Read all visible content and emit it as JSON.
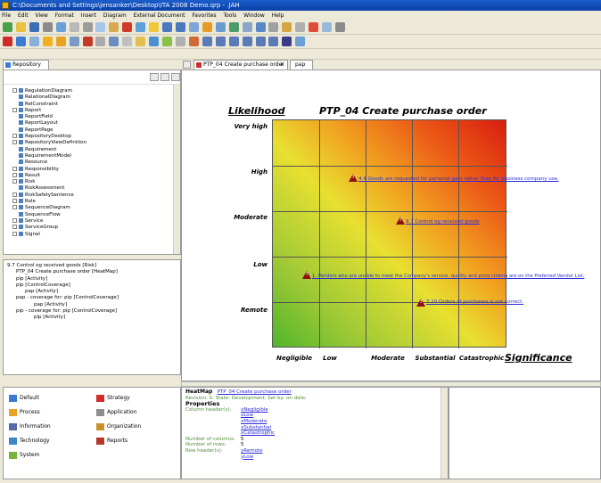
{
  "window": {
    "title": "C:\\Documents and Settings\\jensanker\\Desktop\\ITA 2008 Demo.qrp - .JAH"
  },
  "menu": [
    "File",
    "Edit",
    "View",
    "Format",
    "Insert",
    "Diagram",
    "External Document",
    "Favorites",
    "Tools",
    "Window",
    "Help"
  ],
  "left_tab": {
    "label": "Repository"
  },
  "tree": {
    "items": [
      {
        "label": "RegulationDiagram",
        "expand": true
      },
      {
        "label": "RelationalDiagram",
        "expand": false
      },
      {
        "label": "RelConstraint",
        "expand": false
      },
      {
        "label": "Report",
        "expand": true
      },
      {
        "label": "ReportField",
        "expand": false
      },
      {
        "label": "ReportLayout",
        "expand": false
      },
      {
        "label": "ReportPage",
        "expand": false
      },
      {
        "label": "RepositoryDesktop",
        "expand": true
      },
      {
        "label": "RepositoryViewDefinition",
        "expand": true
      },
      {
        "label": "Requirement",
        "expand": false
      },
      {
        "label": "RequirementModel",
        "expand": false
      },
      {
        "label": "Resource",
        "expand": false
      },
      {
        "label": "Responsibility",
        "expand": true
      },
      {
        "label": "Result",
        "expand": true
      },
      {
        "label": "Risk",
        "expand": true
      },
      {
        "label": "RiskAssessment",
        "expand": false
      },
      {
        "label": "RiskSafetySentence",
        "expand": true
      },
      {
        "label": "Role",
        "expand": true
      },
      {
        "label": "SequenceDiagram",
        "expand": true
      },
      {
        "label": "SequenceFlow",
        "expand": false
      },
      {
        "label": "Service",
        "expand": true
      },
      {
        "label": "ServiceGroup",
        "expand": true
      },
      {
        "label": "Signal",
        "expand": true
      }
    ]
  },
  "subtree": {
    "items": [
      {
        "label": "9.7 Control og received goods [Risk]",
        "indent": 0
      },
      {
        "label": "PTP_04 Create purchase order [HeatMap]",
        "indent": 1
      },
      {
        "label": "pip [Activity]",
        "indent": 1
      },
      {
        "label": "pip [ControlCoverage]",
        "indent": 1
      },
      {
        "label": "pap [Activity]",
        "indent": 2
      },
      {
        "label": "pap - coverage for: pip [ControlCoverage]",
        "indent": 1
      },
      {
        "label": "pap [Activity]",
        "indent": 3
      },
      {
        "label": "pip - coverage for: pip [ControlCoverage]",
        "indent": 1
      },
      {
        "label": "pip [Activity]",
        "indent": 3
      }
    ]
  },
  "editor_tabs": [
    {
      "label": "PTP_04 Create purchase order"
    },
    {
      "label": "pap"
    }
  ],
  "heatmap": {
    "title": "PTP_04 Create purchase order",
    "y_title": "Likelihood",
    "x_title": "Significance",
    "rows": [
      "Very high",
      "High",
      "Moderate",
      "Low",
      "Remote"
    ],
    "columns": [
      "Negligible",
      "Low",
      "Moderate",
      "Substantial",
      "Catastrophic"
    ],
    "risks": [
      {
        "label": "4.4 Goods are requested for personal gain rather than for business company use."
      },
      {
        "label": "9.7 Control og received goods"
      },
      {
        "label": "1. Vendors who are unable to meet the Company’s service, quality and price criteria are on the Preferred Vendor List."
      },
      {
        "label": "7.10 Orders of purchases is not correct."
      }
    ]
  },
  "bottom_left": {
    "items": [
      {
        "label": "Default",
        "color": "#3a7bd5"
      },
      {
        "label": "Strategy",
        "color": "#d62b2b"
      },
      {
        "label": "Process",
        "color": "#e8a323"
      },
      {
        "label": "Application",
        "color": "#8f8f8f"
      },
      {
        "label": "Information",
        "color": "#5a6aa8"
      },
      {
        "label": "Organization",
        "color": "#c8902a"
      },
      {
        "label": "Technology",
        "color": "#3a88c8"
      },
      {
        "label": "Reports",
        "color": "#b3382a"
      },
      {
        "label": "System",
        "color": "#7ab33a"
      }
    ]
  },
  "properties": {
    "type": "HeatMap",
    "name": "PTP_04 Create purchase order",
    "revision_line": "Revision: 0. State: Development. Set by: on date:",
    "section": "Properties",
    "column_headers_label": "Column header(s):",
    "column_headers": [
      "xNegligible",
      "xLow",
      "xModerate",
      "xSubstantial",
      "xCatastrophic"
    ],
    "num_columns_label": "Number of columns:",
    "num_columns": "5",
    "num_rows_label": "Number of rows:",
    "num_rows": "5",
    "row_headers_label": "Row header(s):",
    "row_headers": [
      "yRemote",
      "yLow"
    ]
  }
}
